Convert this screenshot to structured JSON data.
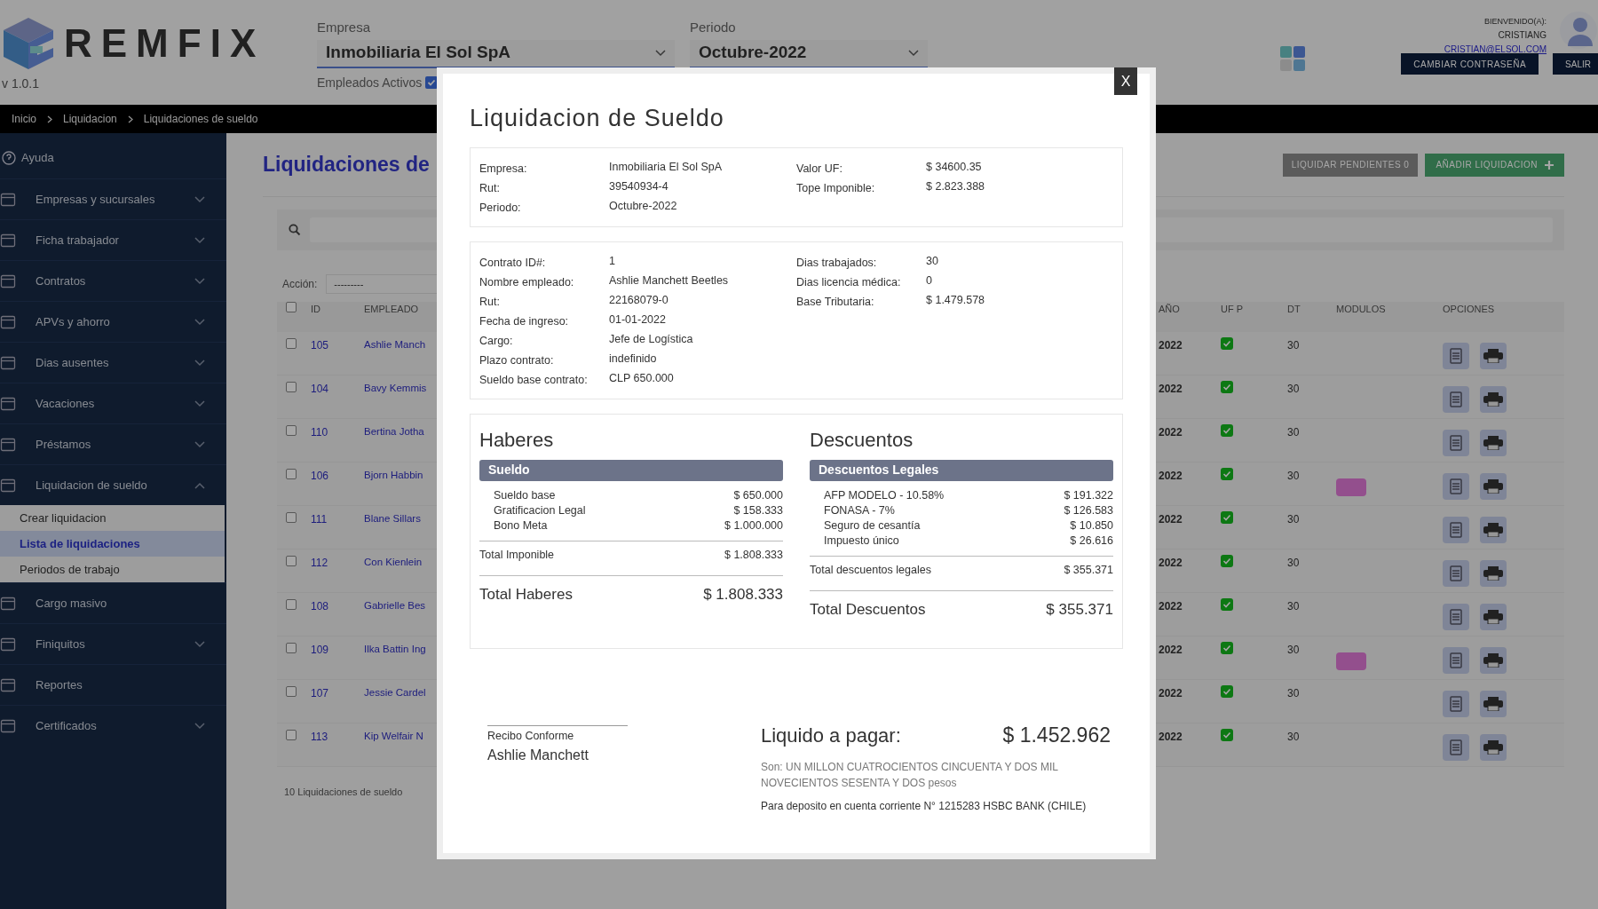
{
  "header": {
    "logo": "REMFIX",
    "version": "v 1.0.1",
    "company": {
      "label": "Empresa",
      "value": "Inmobiliaria El Sol SpA"
    },
    "period": {
      "label": "Periodo",
      "value": "Octubre-2022"
    },
    "active_employees": {
      "label": "Empleados Activos",
      "checked": true
    },
    "user": {
      "greeting": "BIENVENIDO(A):",
      "name": "CRISTIANG",
      "email": "CRISTIAN@ELSOL.COM"
    },
    "buttons": [
      "CAMBIAR CONTRASEÑA",
      "SALIR"
    ]
  },
  "breadcrumb": [
    "Inicio",
    "Liquidacion",
    "Liquidaciones de sueldo"
  ],
  "sidebar": {
    "help": "Ayuda",
    "items": [
      {
        "label": "Empresas y sucursales",
        "kind": "menu",
        "expanded": false
      },
      {
        "label": "Ficha trabajador",
        "kind": "menu",
        "expanded": false
      },
      {
        "label": "Contratos",
        "kind": "menu",
        "expanded": false
      },
      {
        "label": "APVs y ahorro",
        "kind": "menu",
        "expanded": false
      },
      {
        "label": "Dias ausentes",
        "kind": "menu",
        "expanded": false
      },
      {
        "label": "Vacaciones",
        "kind": "menu",
        "expanded": false
      },
      {
        "label": "Préstamos",
        "kind": "menu",
        "expanded": false
      },
      {
        "label": "Liquidacion de sueldo",
        "kind": "menu",
        "expanded": true,
        "children": [
          {
            "label": "Crear liquidacion",
            "selected": false
          },
          {
            "label": "Lista de liquidaciones",
            "selected": true
          },
          {
            "label": "Periodos de trabajo",
            "selected": false
          }
        ]
      },
      {
        "label": "Cargo masivo",
        "kind": "link"
      },
      {
        "label": "Finiquitos",
        "kind": "menu",
        "expanded": false
      },
      {
        "label": "Reportes",
        "kind": "link"
      },
      {
        "label": "Certificados",
        "kind": "menu",
        "expanded": false
      }
    ]
  },
  "main": {
    "title": "Liquidaciones de",
    "buttons": [
      "LIQUIDAR PENDIENTES 0",
      "AÑADIR LIQUIDACION"
    ],
    "action": {
      "label": "Acción:",
      "value": "---------"
    },
    "table": {
      "columns": [
        "ID",
        "EMPLEADO",
        "AÑO",
        "UF P",
        "DT",
        "MODULOS",
        "OPCIONES"
      ],
      "all_checked": false,
      "rows": [
        {
          "id": "105",
          "checked": false,
          "employee": "Ashlie Manch",
          "year": "2022",
          "uf_p": true,
          "dt": "30",
          "module_badge": false
        },
        {
          "id": "104",
          "checked": false,
          "employee": "Bavy Kemmis",
          "year": "2022",
          "uf_p": true,
          "dt": "30",
          "module_badge": false
        },
        {
          "id": "110",
          "checked": false,
          "employee": "Bertina Jotha",
          "year": "2022",
          "uf_p": true,
          "dt": "30",
          "module_badge": false
        },
        {
          "id": "106",
          "checked": false,
          "employee": "Bjorn Habbin",
          "year": "2022",
          "uf_p": true,
          "dt": "30",
          "module_badge": true
        },
        {
          "id": "111",
          "checked": false,
          "employee": "Blane Sillars",
          "year": "2022",
          "uf_p": true,
          "dt": "30",
          "module_badge": false
        },
        {
          "id": "112",
          "checked": false,
          "employee": "Con Kienlein",
          "year": "2022",
          "uf_p": true,
          "dt": "30",
          "module_badge": false
        },
        {
          "id": "108",
          "checked": false,
          "employee": "Gabrielle Bes",
          "year": "2022",
          "uf_p": true,
          "dt": "30",
          "module_badge": false
        },
        {
          "id": "109",
          "checked": false,
          "employee": "Ilka Battin Ing",
          "year": "2022",
          "uf_p": true,
          "dt": "30",
          "module_badge": true
        },
        {
          "id": "107",
          "checked": false,
          "employee": "Jessie Cardel",
          "year": "2022",
          "uf_p": true,
          "dt": "30",
          "module_badge": false
        },
        {
          "id": "113",
          "checked": false,
          "employee": "Kip Welfair N",
          "year": "2022",
          "uf_p": true,
          "dt": "30",
          "module_badge": false
        }
      ],
      "footer": "10 Liquidaciones de sueldo"
    }
  },
  "modal": {
    "close": "X",
    "title": "Liquidacion de Sueldo",
    "company_info": {
      "left": [
        {
          "label": "Empresa:",
          "value": "Inmobiliaria El Sol SpA"
        },
        {
          "label": "Rut:",
          "value": "39540934-4"
        },
        {
          "label": "Periodo:",
          "value": "Octubre-2022"
        }
      ],
      "right": [
        {
          "label": "Valor UF:",
          "value": "$ 34600.35"
        },
        {
          "label": "Tope Imponible:",
          "value": "$ 2.823.388"
        }
      ]
    },
    "contract_info": {
      "left": [
        {
          "label": "Contrato ID#:",
          "value": "1"
        },
        {
          "label": "Nombre empleado:",
          "value": "Ashlie Manchett Beetles"
        },
        {
          "label": "Rut:",
          "value": "22168079-0"
        },
        {
          "label": "Fecha de ingreso:",
          "value": "01-01-2022"
        },
        {
          "label": "Cargo:",
          "value": "Jefe de Logística"
        },
        {
          "label": "Plazo contrato:",
          "value": "indefinido"
        },
        {
          "label": "Sueldo base contrato:",
          "value": "CLP 650.000"
        }
      ],
      "right": [
        {
          "label": "Dias trabajados:",
          "value": "30"
        },
        {
          "label": "Dias licencia médica:",
          "value": "0"
        },
        {
          "label": "Base Tributaria:",
          "value": "$ 1.479.578"
        }
      ]
    },
    "haberes": {
      "title": "Haberes",
      "group": "Sueldo",
      "items": [
        {
          "label": "Sueldo base",
          "amount": "$ 650.000"
        },
        {
          "label": "Gratificacion Legal",
          "amount": "$ 158.333"
        },
        {
          "label": "Bono Meta",
          "amount": "$ 1.000.000"
        }
      ],
      "subtotal": {
        "label": "Total Imponible",
        "amount": "$ 1.808.333"
      },
      "total": {
        "label": "Total Haberes",
        "amount": "$ 1.808.333"
      }
    },
    "descuentos": {
      "title": "Descuentos",
      "group": "Descuentos Legales",
      "items": [
        {
          "label": "AFP MODELO - 10.58%",
          "amount": "$ 191.322"
        },
        {
          "label": "FONASA - 7%",
          "amount": "$ 126.583"
        },
        {
          "label": "Seguro de cesantía",
          "amount": "$ 10.850"
        },
        {
          "label": "Impuesto único",
          "amount": "$ 26.616"
        }
      ],
      "subtotal": {
        "label": "Total descuentos legales",
        "amount": "$ 355.371"
      },
      "total": {
        "label": "Total Descuentos",
        "amount": "$ 355.371"
      }
    },
    "signature": {
      "caption": "Recibo Conforme",
      "name": "Ashlie Manchett"
    },
    "payment": {
      "label": "Liquido a pagar:",
      "amount": "$ 1.452.962",
      "in_words": "Son: UN MILLON CUATROCIENTOS CINCUENTA Y DOS MIL NOVECIENTOS SESENTA Y DOS pesos",
      "deposit": "Para deposito en cuenta corriente N° 1215283 HSBC BANK (CHILE)"
    }
  }
}
